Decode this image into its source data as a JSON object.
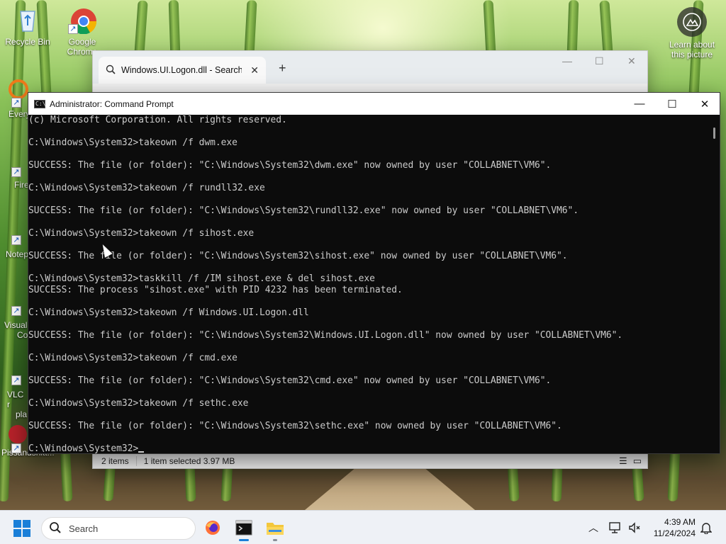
{
  "desktop": {
    "icons": [
      {
        "label": "Recycle Bin"
      },
      {
        "label": "Google Chrome"
      }
    ],
    "partial_labels": [
      "Every",
      "Fire",
      "Notep",
      "Visual",
      "Co",
      "VLC r",
      "pla",
      "Pissandshitt..."
    ],
    "learn_label": "Learn about this picture"
  },
  "explorer": {
    "tab_title": "Windows.UI.Logon.dll - Search",
    "status_items": "2 items",
    "status_selected": "1 item selected  3.97 MB"
  },
  "cmd": {
    "title": "Administrator: Command Prompt",
    "lines": [
      "(c) Microsoft Corporation. All rights reserved.",
      "",
      "C:\\Windows\\System32>takeown /f dwm.exe",
      "",
      "SUCCESS: The file (or folder): \"C:\\Windows\\System32\\dwm.exe\" now owned by user \"COLLABNET\\VM6\".",
      "",
      "C:\\Windows\\System32>takeown /f rundll32.exe",
      "",
      "SUCCESS: The file (or folder): \"C:\\Windows\\System32\\rundll32.exe\" now owned by user \"COLLABNET\\VM6\".",
      "",
      "C:\\Windows\\System32>takeown /f sihost.exe",
      "",
      "SUCCESS: The file (or folder): \"C:\\Windows\\System32\\sihost.exe\" now owned by user \"COLLABNET\\VM6\".",
      "",
      "C:\\Windows\\System32>taskkill /f /IM sihost.exe & del sihost.exe",
      "SUCCESS: The process \"sihost.exe\" with PID 4232 has been terminated.",
      "",
      "C:\\Windows\\System32>takeown /f Windows.UI.Logon.dll",
      "",
      "SUCCESS: The file (or folder): \"C:\\Windows\\System32\\Windows.UI.Logon.dll\" now owned by user \"COLLABNET\\VM6\".",
      "",
      "C:\\Windows\\System32>takeown /f cmd.exe",
      "",
      "SUCCESS: The file (or folder): \"C:\\Windows\\System32\\cmd.exe\" now owned by user \"COLLABNET\\VM6\".",
      "",
      "C:\\Windows\\System32>takeown /f sethc.exe",
      "",
      "SUCCESS: The file (or folder): \"C:\\Windows\\System32\\sethc.exe\" now owned by user \"COLLABNET\\VM6\".",
      ""
    ],
    "prompt": "C:\\Windows\\System32>"
  },
  "taskbar": {
    "search_placeholder": "Search",
    "time": "4:39 AM",
    "date": "11/24/2024"
  },
  "colors": {
    "accent": "#1a7fd8",
    "console_bg": "#0c0c0c",
    "console_fg": "#cccccc"
  }
}
